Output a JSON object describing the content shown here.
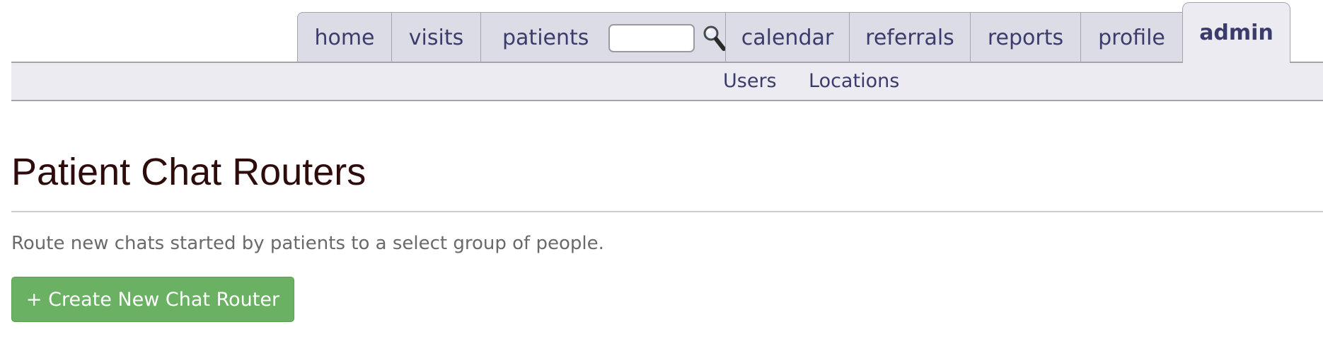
{
  "nav": {
    "tabs": [
      {
        "label": "home"
      },
      {
        "label": "visits"
      },
      {
        "label": "patients"
      },
      {
        "label": "calendar"
      },
      {
        "label": "referrals"
      },
      {
        "label": "reports"
      },
      {
        "label": "profile"
      },
      {
        "label": "admin"
      }
    ],
    "active_tab": "admin",
    "patient_search": {
      "value": "",
      "icon": "search-icon"
    }
  },
  "subnav": {
    "items": [
      {
        "label": "Users"
      },
      {
        "label": "Locations"
      }
    ]
  },
  "main": {
    "title": "Patient Chat Routers",
    "description": "Route new chats started by patients to a select group of people.",
    "create_button_label": "+ Create New Chat Router"
  },
  "colors": {
    "tab_bg": "#dcdce6",
    "active_tab_bg": "#ebebf1",
    "nav_text": "#3c3c6c",
    "title": "#2e0c0c",
    "button_green": "#6ab163"
  }
}
